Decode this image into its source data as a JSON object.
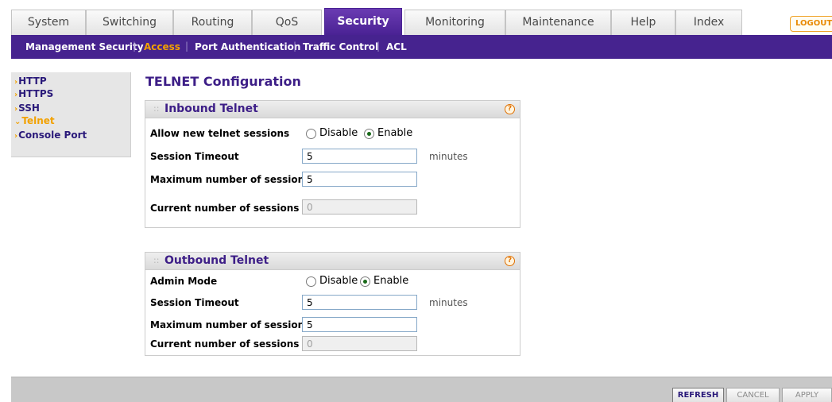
{
  "tabs": [
    {
      "label": "System"
    },
    {
      "label": "Switching"
    },
    {
      "label": "Routing"
    },
    {
      "label": "QoS"
    },
    {
      "label": "Security",
      "active": true
    },
    {
      "label": "Monitoring"
    },
    {
      "label": "Maintenance"
    },
    {
      "label": "Help"
    },
    {
      "label": "Index"
    }
  ],
  "logout_label": "LOGOUT",
  "subnav": [
    {
      "label": "Management Security"
    },
    {
      "label": "Access",
      "active": true
    },
    {
      "label": "Port Authentication"
    },
    {
      "label": "Traffic Control"
    },
    {
      "label": "ACL"
    }
  ],
  "subnav_separator": "|",
  "menu_arrow": "›",
  "menu_arrow_open": "⌄",
  "leftmenu": [
    {
      "label": "HTTP"
    },
    {
      "label": "HTTPS"
    },
    {
      "label": "SSH"
    },
    {
      "label": "Telnet",
      "active": true
    },
    {
      "label": "Console Port"
    }
  ],
  "page_title": "TELNET Configuration",
  "panel_grip": "::",
  "help_glyph": "?",
  "inbound": {
    "title": "Inbound Telnet",
    "allow_label": "Allow new telnet sessions",
    "disable_label": "Disable",
    "enable_label": "Enable",
    "selected": "Enable",
    "timeout_label": "Session Timeout",
    "timeout_value": "5",
    "timeout_unit": "minutes",
    "max_label": "Maximum number of sessions",
    "max_value": "5",
    "current_label": "Current number of sessions",
    "current_value": "0"
  },
  "outbound": {
    "title": "Outbound Telnet",
    "admin_label": "Admin Mode",
    "disable_label": "Disable",
    "enable_label": "Enable",
    "selected": "Enable",
    "timeout_label": "Session Timeout",
    "timeout_value": "5",
    "timeout_unit": "minutes",
    "max_label": "Maximum number of sessions",
    "max_value": "5",
    "current_label": "Current number of sessions",
    "current_value": "0"
  },
  "buttons": {
    "refresh": "REFRESH",
    "cancel": "CANCEL",
    "apply": "APPLY"
  },
  "colors": {
    "brand_purple": "#46238f",
    "accent_orange": "#f2a100",
    "title_purple": "#3d1e87"
  }
}
